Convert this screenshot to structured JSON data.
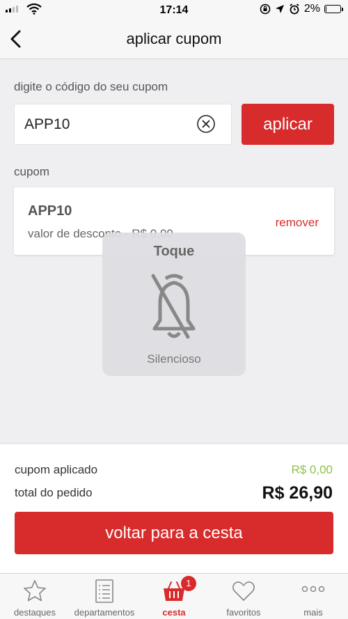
{
  "status_bar": {
    "time": "17:14",
    "battery_percent": "2%",
    "battery_level": 0.02
  },
  "nav": {
    "title": "aplicar cupom"
  },
  "coupon_form": {
    "label": "digite o código do seu cupom",
    "value": "APP10",
    "apply_label": "aplicar"
  },
  "coupon_section": {
    "label": "cupom",
    "code": "APP10",
    "discount": "valor de desconto - R$ 0,00",
    "remove_label": "remover"
  },
  "hud": {
    "title": "Toque",
    "caption": "Silencioso"
  },
  "summary": {
    "coupon_label": "cupom aplicado",
    "coupon_value": "R$ 0,00",
    "total_label": "total do pedido",
    "total_value": "R$ 26,90",
    "button_label": "voltar para a cesta"
  },
  "tabs": [
    {
      "label": "destaques",
      "icon": "star-icon"
    },
    {
      "label": "departamentos",
      "icon": "list-icon"
    },
    {
      "label": "cesta",
      "icon": "basket-icon",
      "badge": "1",
      "active": true
    },
    {
      "label": "favoritos",
      "icon": "heart-icon"
    },
    {
      "label": "mais",
      "icon": "more-icon"
    }
  ],
  "colors": {
    "accent": "#d82b2b",
    "discount_green": "#8bc34a"
  }
}
